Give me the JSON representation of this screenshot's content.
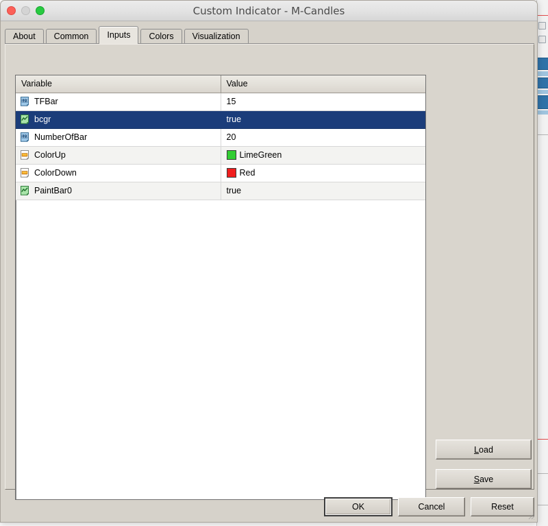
{
  "window": {
    "title": "Custom Indicator - M-Candles",
    "controls": [
      {
        "name": "close",
        "color": "#fc6058"
      },
      {
        "name": "minimize",
        "color": "#d4d4d4"
      },
      {
        "name": "maximize",
        "color": "#28ca41"
      }
    ]
  },
  "tabs": [
    {
      "label": "About",
      "active": false
    },
    {
      "label": "Common",
      "active": false
    },
    {
      "label": "Inputs",
      "active": true
    },
    {
      "label": "Colors",
      "active": false
    },
    {
      "label": "Visualization",
      "active": false
    }
  ],
  "table": {
    "columns": [
      "Variable",
      "Value"
    ],
    "rows": [
      {
        "icon": "integer-icon",
        "variable": "TFBar",
        "value": "15",
        "value_kind": "text",
        "selected": false,
        "stripe": "white"
      },
      {
        "icon": "boolean-icon",
        "variable": "bcgr",
        "value": "true",
        "value_kind": "text",
        "selected": true,
        "stripe": "sel"
      },
      {
        "icon": "integer-icon",
        "variable": "NumberOfBar",
        "value": "20",
        "value_kind": "text",
        "selected": false,
        "stripe": "white"
      },
      {
        "icon": "color-icon",
        "variable": "ColorUp",
        "value": "LimeGreen",
        "value_kind": "color",
        "swatch": "#32cd32",
        "selected": false,
        "stripe": "alt"
      },
      {
        "icon": "color-icon",
        "variable": "ColorDown",
        "value": "Red",
        "value_kind": "color",
        "swatch": "#f01e1e",
        "selected": false,
        "stripe": "white"
      },
      {
        "icon": "boolean-icon",
        "variable": "PaintBar0",
        "value": "true",
        "value_kind": "text",
        "selected": false,
        "stripe": "alt"
      }
    ]
  },
  "side_buttons": [
    {
      "name": "load-button",
      "label_pre": "",
      "label_acc": "L",
      "label_post": "oad"
    },
    {
      "name": "save-button",
      "label_pre": "",
      "label_acc": "S",
      "label_post": "ave"
    }
  ],
  "footer_buttons": [
    {
      "name": "ok-button",
      "label": "OK",
      "default": true
    },
    {
      "name": "cancel-button",
      "label": "Cancel",
      "default": false
    },
    {
      "name": "reset-button",
      "label": "Reset",
      "default": false
    }
  ],
  "background": {
    "top_text": "............",
    "accent_red": "#e04b4b",
    "accent_blue": "#2f72a8"
  },
  "colors": {
    "selection": "#1b3d7a",
    "window_face": "#d6d2ca",
    "grid_background": "#ffffff",
    "stripe": "#f3f3f1"
  }
}
